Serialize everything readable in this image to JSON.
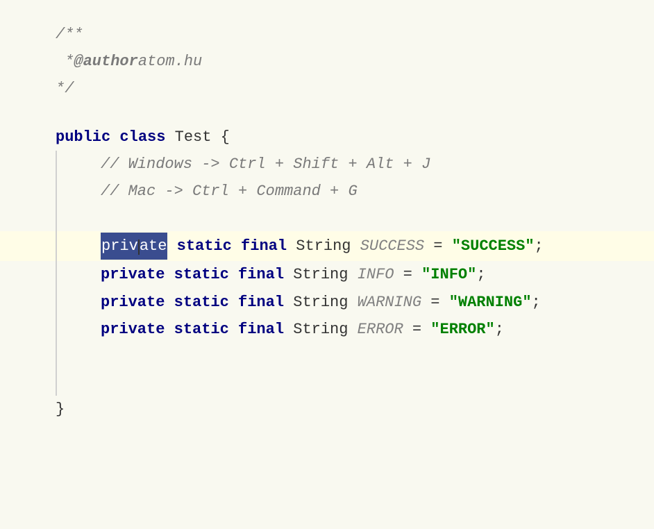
{
  "code": {
    "bg_color": "#f9f9f0",
    "highlight_color": "#fffde7",
    "selected_bg": "#3a4d8f",
    "lines": [
      {
        "id": "comment-open",
        "type": "comment",
        "text": "/**",
        "indent": 0
      },
      {
        "id": "comment-author",
        "type": "comment-author",
        "prefix": " * ",
        "tag": "@author",
        "value": " atom.hu",
        "indent": 0
      },
      {
        "id": "comment-close",
        "type": "comment",
        "text": " */",
        "indent": 0
      },
      {
        "id": "blank-1",
        "type": "blank"
      },
      {
        "id": "class-decl",
        "type": "class-decl",
        "keyword1": "public",
        "keyword2": "class",
        "name": "Test",
        "brace": "{",
        "indent": 0
      },
      {
        "id": "comment-windows",
        "type": "comment-inline",
        "text": "// Windows -> Ctrl + Shift + Alt + J",
        "indent": 2
      },
      {
        "id": "comment-mac",
        "type": "comment-inline",
        "text": "// Mac -> Ctrl + Command + G",
        "indent": 2
      },
      {
        "id": "blank-2",
        "type": "blank"
      },
      {
        "id": "field-success",
        "type": "field-line",
        "highlighted": true,
        "selected": "private",
        "rest_keywords": " static final",
        "type_name": " String ",
        "var_name": "SUCCESS",
        "operator": " = ",
        "value": "\"SUCCESS\"",
        "semi": ";",
        "indent": 3
      },
      {
        "id": "field-info",
        "type": "field-line",
        "highlighted": false,
        "keywords": "private static final",
        "type_name": " String ",
        "var_name": "INFO",
        "operator": " = ",
        "value": "\"INFO\"",
        "semi": ";",
        "indent": 3
      },
      {
        "id": "field-warning",
        "type": "field-line",
        "highlighted": false,
        "keywords": "private static final",
        "type_name": " String ",
        "var_name": "WARNING",
        "operator": " = ",
        "value": "\"WARNING\"",
        "semi": ";",
        "indent": 3
      },
      {
        "id": "field-error",
        "type": "field-line",
        "highlighted": false,
        "keywords": "private static final",
        "type_name": " String ",
        "var_name": "ERROR",
        "operator": " = ",
        "value": "\"ERROR\"",
        "semi": ";",
        "indent": 3
      },
      {
        "id": "blank-3",
        "type": "blank"
      },
      {
        "id": "blank-4",
        "type": "blank"
      },
      {
        "id": "class-close",
        "type": "brace-close",
        "text": "}",
        "indent": 0
      }
    ]
  }
}
